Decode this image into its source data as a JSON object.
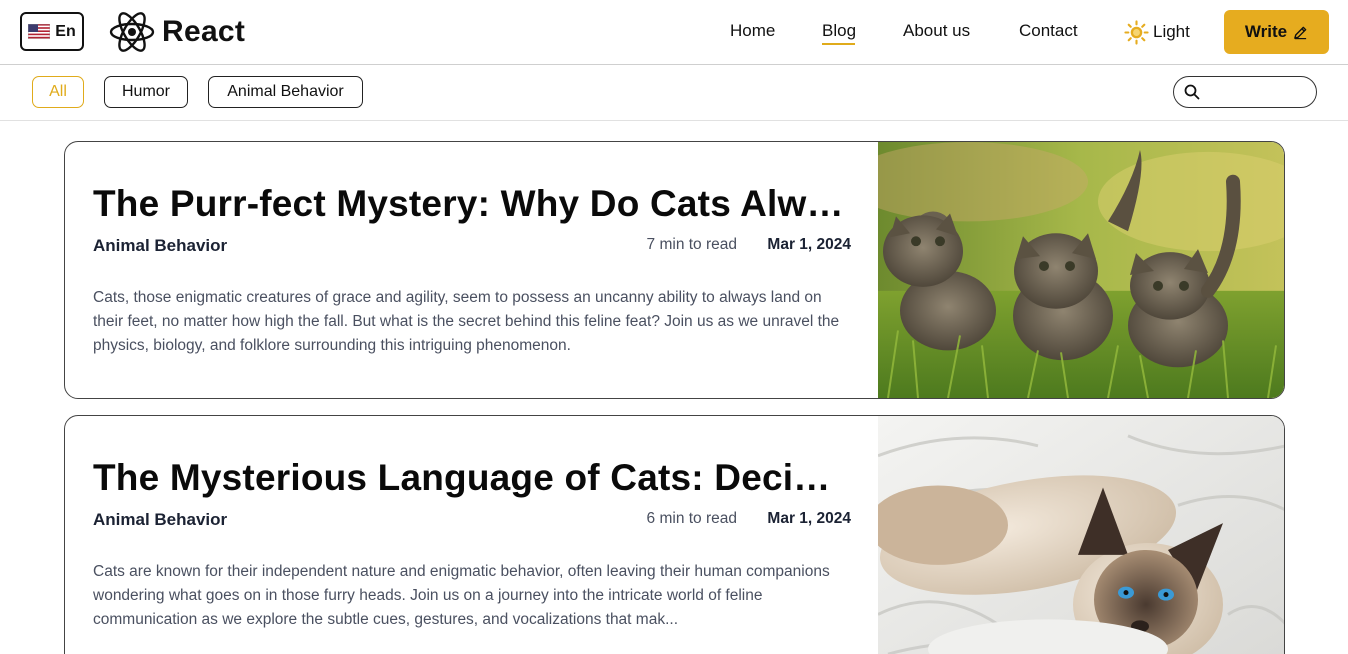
{
  "header": {
    "language_label": "En",
    "brand_name": "React",
    "nav": [
      {
        "label": "Home",
        "active": false
      },
      {
        "label": "Blog",
        "active": true
      },
      {
        "label": "About us",
        "active": false
      },
      {
        "label": "Contact",
        "active": false
      }
    ],
    "theme_label": "Light",
    "write_label": "Write",
    "accent_color": "#E6AC1F"
  },
  "filters": {
    "categories": [
      {
        "label": "All",
        "active": true
      },
      {
        "label": "Humor",
        "active": false
      },
      {
        "label": "Animal Behavior",
        "active": false
      }
    ],
    "search_value": ""
  },
  "posts": [
    {
      "title": "The Purr-fect Mystery: Why Do Cats Alwa...",
      "category": "Animal Behavior",
      "read_time": "7 min to read",
      "date": "Mar 1, 2024",
      "excerpt": "Cats, those enigmatic creatures of grace and agility, seem to possess an uncanny ability to always land on their feet, no matter how high the fall. But what is the secret behind this feline feat? Join us as we unravel the physics, biology, and folklore surrounding this intriguing phenomenon.",
      "image": "three-kittens-in-grass"
    },
    {
      "title": "The Mysterious Language of Cats: Deciph...",
      "category": "Animal Behavior",
      "read_time": "6 min to read",
      "date": "Mar 1, 2024",
      "excerpt": "Cats are known for their independent nature and enigmatic behavior, often leaving their human companions wondering what goes on in those furry heads. Join us on a journey into the intricate world of feline communication as we explore the subtle cues, gestures, and vocalizations that mak...",
      "image": "siamese-cat-on-white-blanket"
    }
  ]
}
